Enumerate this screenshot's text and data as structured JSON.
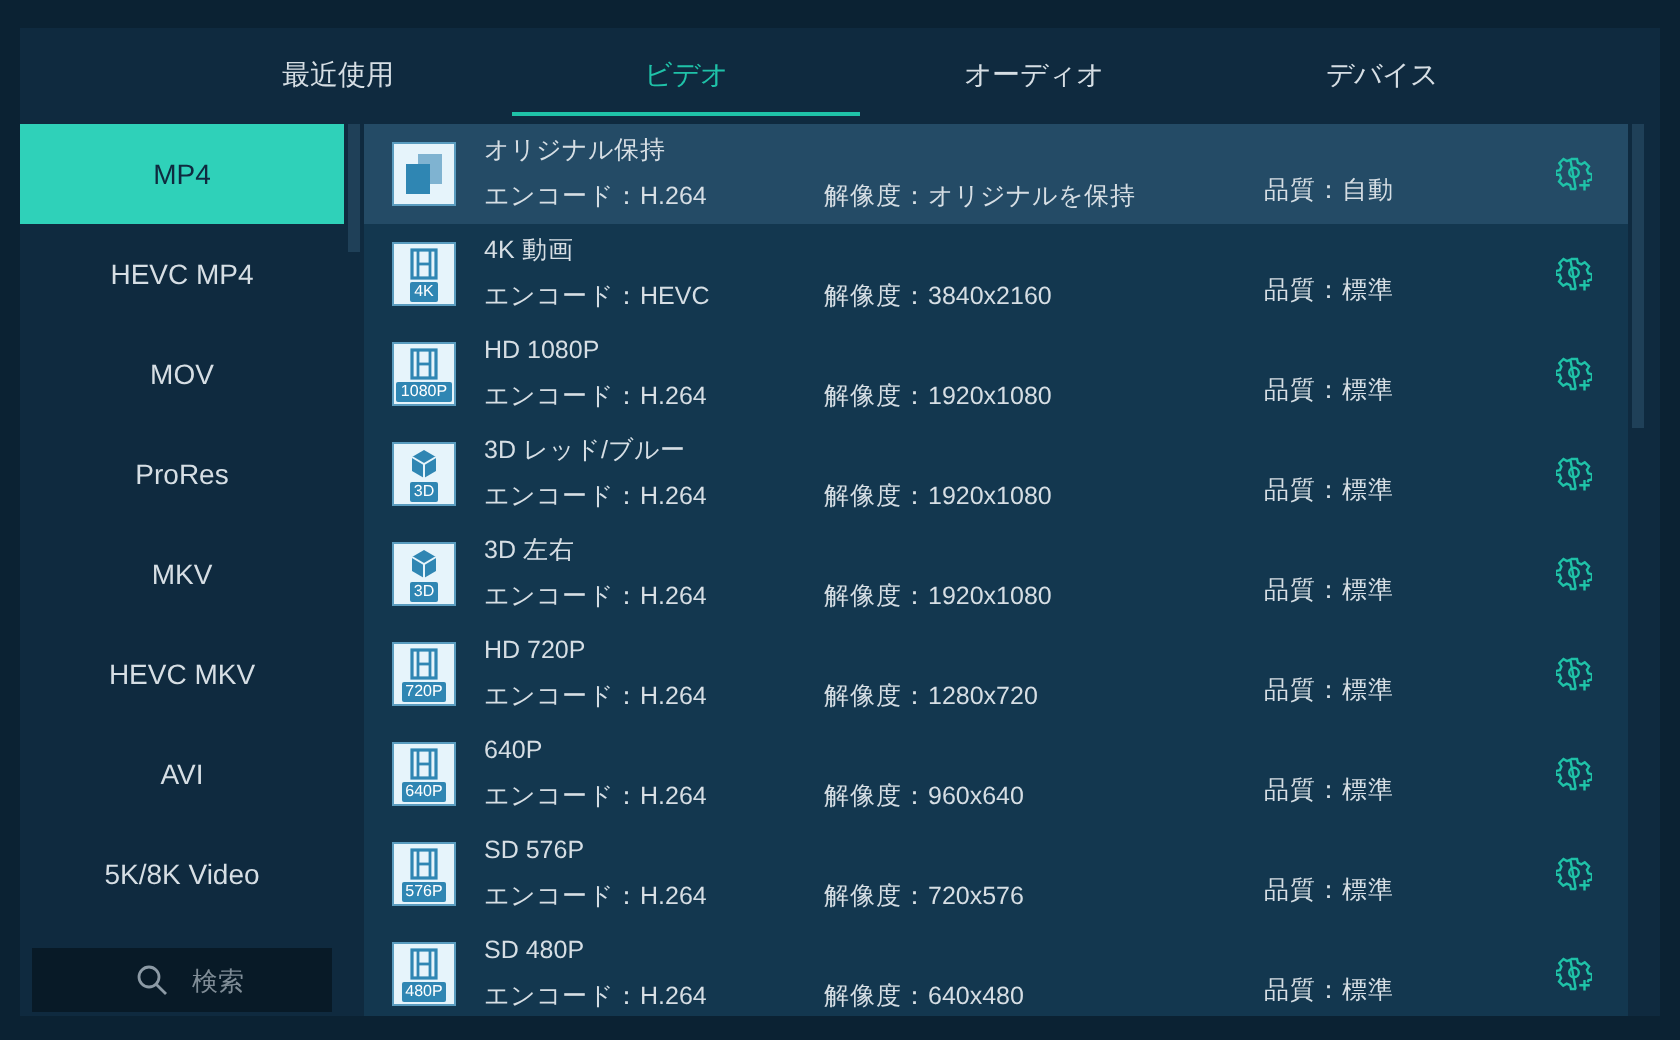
{
  "tabs": [
    {
      "label": "最近使用",
      "selected": false
    },
    {
      "label": "ビデオ",
      "selected": true
    },
    {
      "label": "オーディオ",
      "selected": false
    },
    {
      "label": "デバイス",
      "selected": false
    }
  ],
  "formats": [
    {
      "label": "MP4",
      "selected": true
    },
    {
      "label": "HEVC MP4",
      "selected": false
    },
    {
      "label": "MOV",
      "selected": false
    },
    {
      "label": "ProRes",
      "selected": false
    },
    {
      "label": "MKV",
      "selected": false
    },
    {
      "label": "HEVC MKV",
      "selected": false
    },
    {
      "label": "AVI",
      "selected": false
    },
    {
      "label": "5K/8K Video",
      "selected": false
    }
  ],
  "search": {
    "placeholder": "検索"
  },
  "presets": [
    {
      "kind": "original",
      "name": "オリジナル保持",
      "encode": "エンコード：H.264",
      "resolution": "解像度：オリジナルを保持",
      "quality": "品質：自動",
      "selected": true
    },
    {
      "kind": "film",
      "badge": "4K",
      "name": "4K 動画",
      "encode": "エンコード：HEVC",
      "resolution": "解像度：3840x2160",
      "quality": "品質：標準",
      "selected": false
    },
    {
      "kind": "film",
      "badge": "1080P",
      "name": "HD 1080P",
      "encode": "エンコード：H.264",
      "resolution": "解像度：1920x1080",
      "quality": "品質：標準",
      "selected": false
    },
    {
      "kind": "cube",
      "badge": "3D",
      "name": "3D レッド/ブルー",
      "encode": "エンコード：H.264",
      "resolution": "解像度：1920x1080",
      "quality": "品質：標準",
      "selected": false
    },
    {
      "kind": "cube",
      "badge": "3D",
      "name": "3D 左右",
      "encode": "エンコード：H.264",
      "resolution": "解像度：1920x1080",
      "quality": "品質：標準",
      "selected": false
    },
    {
      "kind": "film",
      "badge": "720P",
      "name": "HD 720P",
      "encode": "エンコード：H.264",
      "resolution": "解像度：1280x720",
      "quality": "品質：標準",
      "selected": false
    },
    {
      "kind": "film",
      "badge": "640P",
      "name": "640P",
      "encode": "エンコード：H.264",
      "resolution": "解像度：960x640",
      "quality": "品質：標準",
      "selected": false
    },
    {
      "kind": "film",
      "badge": "576P",
      "name": "SD 576P",
      "encode": "エンコード：H.264",
      "resolution": "解像度：720x576",
      "quality": "品質：標準",
      "selected": false
    },
    {
      "kind": "film",
      "badge": "480P",
      "name": "SD 480P",
      "encode": "エンコード：H.264",
      "resolution": "解像度：640x480",
      "quality": "品質：標準",
      "selected": false
    }
  ]
}
